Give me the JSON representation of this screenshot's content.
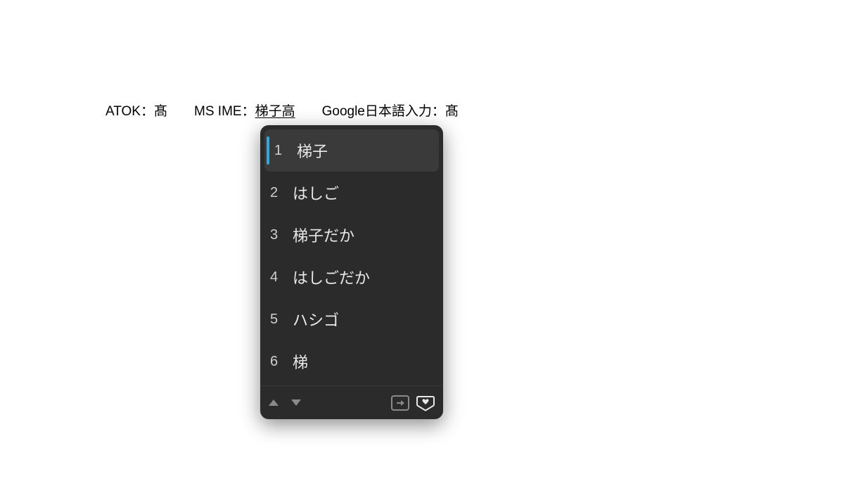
{
  "textline": {
    "atok_label": "ATOK：",
    "atok_value": "髙",
    "spacer1": "　　",
    "msime_label": "MS IME：",
    "msime_value": "梯子高",
    "spacer2": "　　",
    "google_label": "Google日本語入力：",
    "google_value": "髙"
  },
  "candidates": [
    {
      "num": "1",
      "text": "梯子"
    },
    {
      "num": "2",
      "text": "はしご"
    },
    {
      "num": "3",
      "text": "梯子だか"
    },
    {
      "num": "4",
      "text": "はしごだか"
    },
    {
      "num": "5",
      "text": "ハシゴ"
    },
    {
      "num": "6",
      "text": "梯"
    }
  ],
  "selected_index": 0
}
